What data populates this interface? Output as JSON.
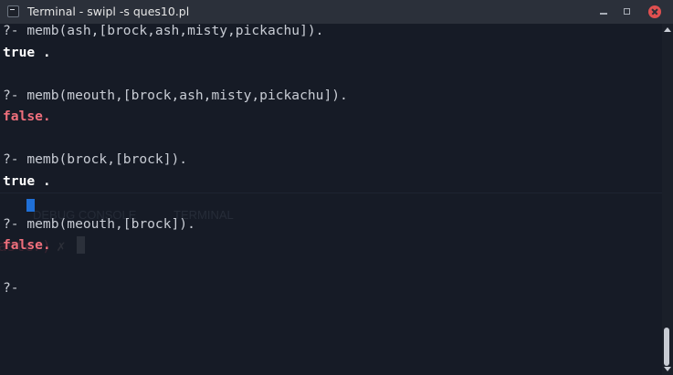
{
  "window": {
    "title": "Terminal - swipl -s ques10.pl",
    "app_icon": "terminal-icon",
    "controls": [
      "minimize-icon",
      "maximize-icon",
      "close-icon"
    ]
  },
  "colors": {
    "terminal_bg": "#161b26",
    "titlebar_bg": "#2b303a",
    "query_text": "#c8ccd4",
    "true_text": "#ffffff",
    "false_text": "#f06f7c",
    "cursor": "#1f6fd6",
    "close_button": "#e05050"
  },
  "terminal": {
    "lines": [
      {
        "text": "?- memb(ash,[brock,ash,misty,pickachu]).",
        "kind": "query"
      },
      {
        "text": "true .",
        "kind": "true"
      },
      {
        "text": "",
        "kind": "blank"
      },
      {
        "text": "?- memb(meouth,[brock,ash,misty,pickachu]).",
        "kind": "query"
      },
      {
        "text": "false.",
        "kind": "false"
      },
      {
        "text": "",
        "kind": "blank"
      },
      {
        "text": "?- memb(brock,[brock]).",
        "kind": "query"
      },
      {
        "text": "true .",
        "kind": "true"
      },
      {
        "text": "",
        "kind": "blank"
      },
      {
        "text": "?- memb(meouth,[brock]).",
        "kind": "query"
      },
      {
        "text": "false.",
        "kind": "false"
      },
      {
        "text": "",
        "kind": "blank"
      },
      {
        "text": "?- ",
        "kind": "query"
      }
    ]
  },
  "background_ghost": {
    "debug_console": "DEBUG CONSOLE",
    "terminal_tab": "TERMINAL",
    "branch": "aster)",
    "mark": "✗"
  }
}
